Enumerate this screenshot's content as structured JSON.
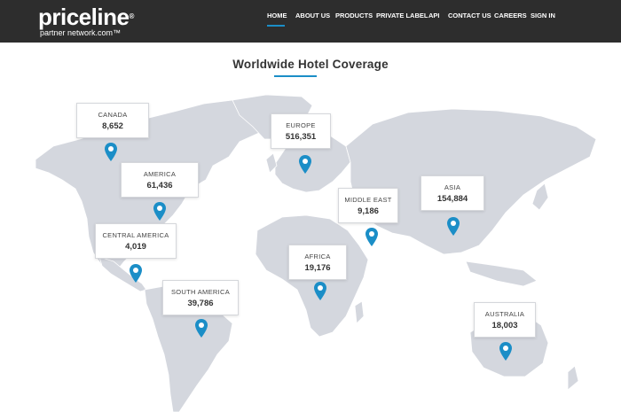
{
  "brand": {
    "name": "priceline",
    "mark": "®",
    "tagline": "partner network.com™"
  },
  "nav": {
    "items": [
      "HOME",
      "ABOUT US",
      "PRODUCTS",
      "PRIVATE LABEL",
      "API",
      "CONTACT US",
      "CAREERS",
      "SIGN IN"
    ],
    "active": "HOME"
  },
  "page": {
    "title": "Worldwide Hotel Coverage"
  },
  "regions": [
    {
      "name": "CANADA",
      "count": "8,652"
    },
    {
      "name": "AMERICA",
      "count": "61,436"
    },
    {
      "name": "CENTRAL AMERICA",
      "count": "4,019"
    },
    {
      "name": "SOUTH AMERICA",
      "count": "39,786"
    },
    {
      "name": "EUROPE",
      "count": "516,351"
    },
    {
      "name": "AFRICA",
      "count": "19,176"
    },
    {
      "name": "MIDDLE EAST",
      "count": "9,186"
    },
    {
      "name": "ASIA",
      "count": "154,884"
    },
    {
      "name": "AUSTRALIA",
      "count": "18,003"
    }
  ],
  "colors": {
    "header": "#2d2d2d",
    "accent": "#1b8ec7",
    "land": "#d4d7de",
    "pin": "#1b8ec7"
  },
  "icons": {
    "pin": "map-marker-icon"
  }
}
